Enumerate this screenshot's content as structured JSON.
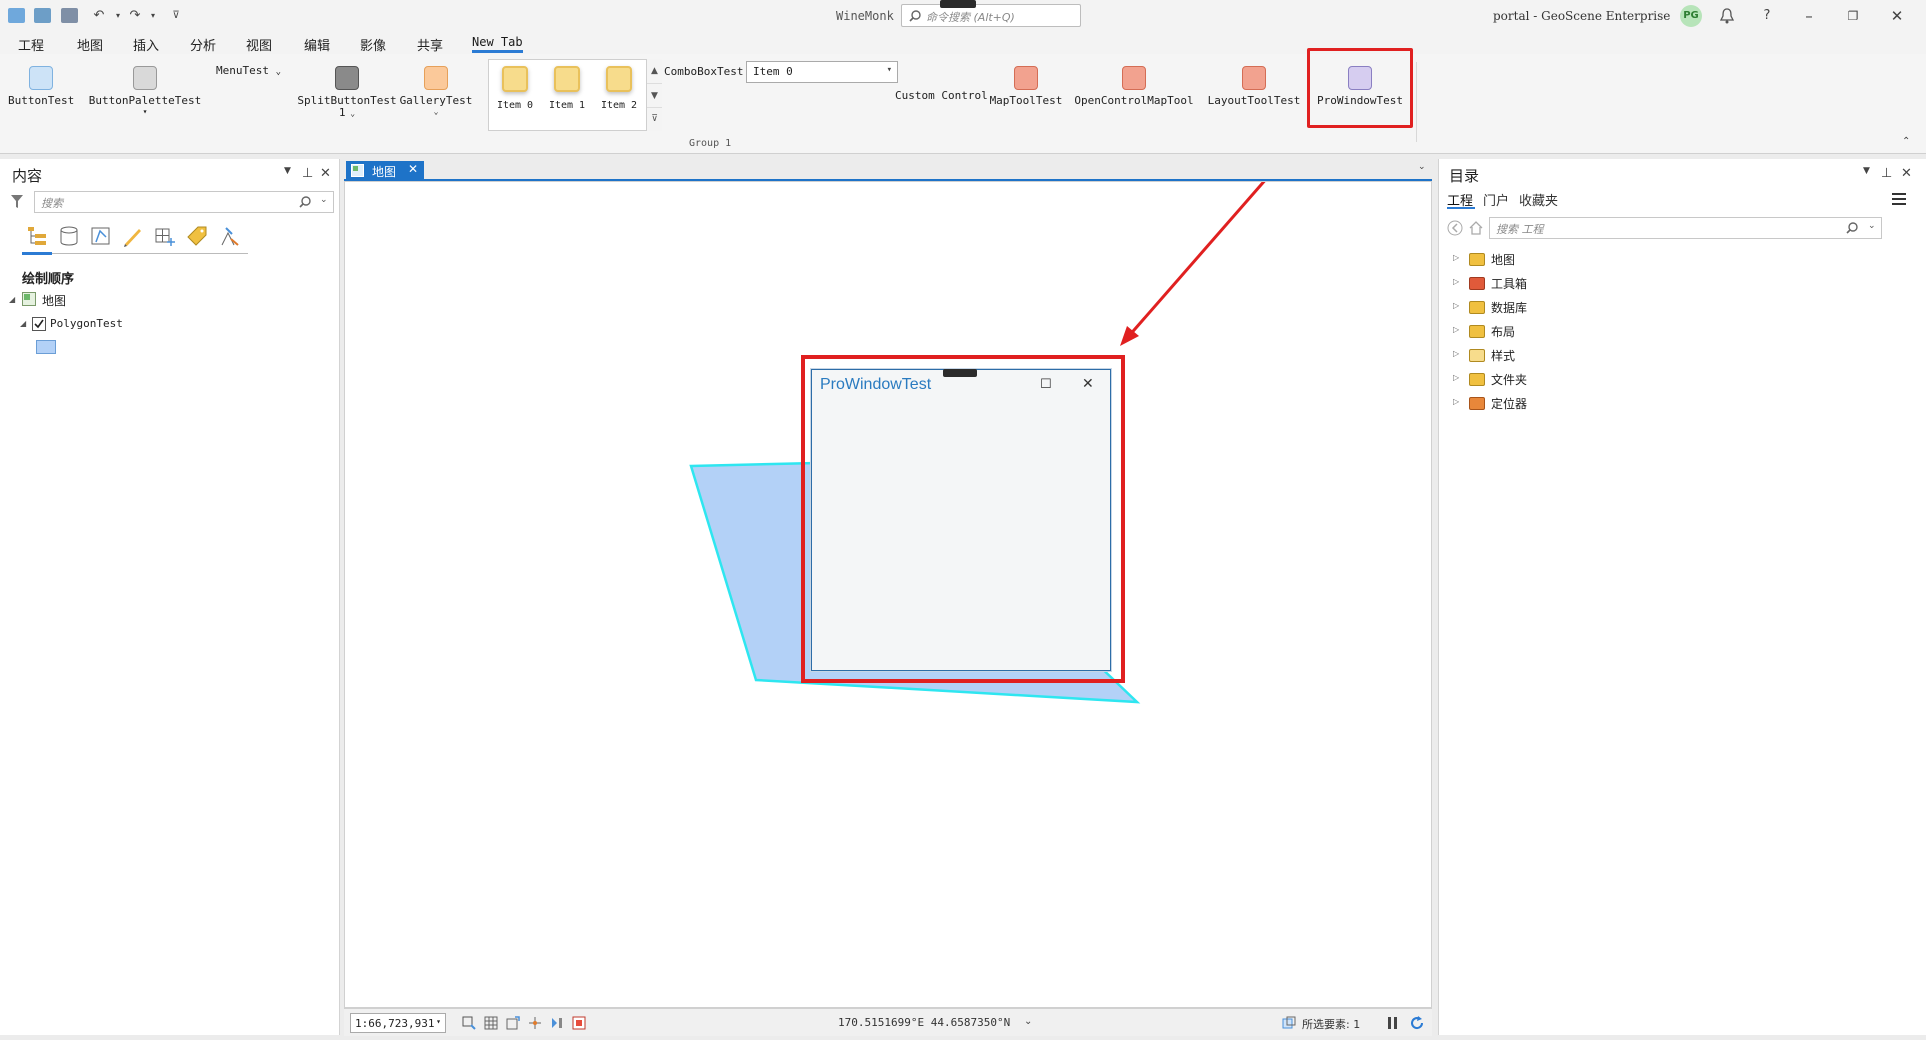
{
  "titlebar": {
    "app_title": "WineMonk",
    "search_placeholder": "命令搜索 (Alt+Q)",
    "portal": "portal - GeoScene Enterprise",
    "avatar": "PG",
    "help": "?"
  },
  "ribbon_tabs": [
    "工程",
    "地图",
    "插入",
    "分析",
    "视图",
    "编辑",
    "影像",
    "共享",
    "New Tab"
  ],
  "ribbon": {
    "button_test": "ButtonTest",
    "button_palette_test": "ButtonPaletteTest",
    "menu_test": "MenuTest",
    "split_button_test_1": "SplitButtonTest",
    "split_button_test_2": "1",
    "gallery_test": "GalleryTest",
    "gallery_items": [
      "Item 0",
      "Item 1",
      "Item 2"
    ],
    "combo_label": "ComboBoxTest",
    "combo_value": "Item 0",
    "custom_control": "Custom Control",
    "map_tool_test": "MapToolTest",
    "open_control_map_tool": "OpenControlMapTool",
    "layout_tool_test": "LayoutToolTest",
    "pro_window_test": "ProWindowTest",
    "group_label": "Group 1"
  },
  "contents": {
    "title": "内容",
    "search_placeholder": "搜索",
    "drawing_order": "绘制顺序",
    "map_node": "地图",
    "layer_name": "PolygonTest"
  },
  "map_view": {
    "tab_label": "地图",
    "scale": "1:66,723,931",
    "coordinates": "170.5151699°E 44.6587350°N",
    "selected_features": "所选要素: 1"
  },
  "pro_window": {
    "title": "ProWindowTest"
  },
  "catalog": {
    "title": "目录",
    "tabs": [
      "工程",
      "门户",
      "收藏夹"
    ],
    "search_placeholder": "搜索 工程",
    "items": [
      "地图",
      "工具箱",
      "数据库",
      "布局",
      "样式",
      "文件夹",
      "定位器"
    ]
  },
  "colors": {
    "accent": "#1e73c8",
    "highlight": "#e02020",
    "polygon_fill": "#b3d1f7",
    "polygon_stroke": "#2ee6f0"
  }
}
